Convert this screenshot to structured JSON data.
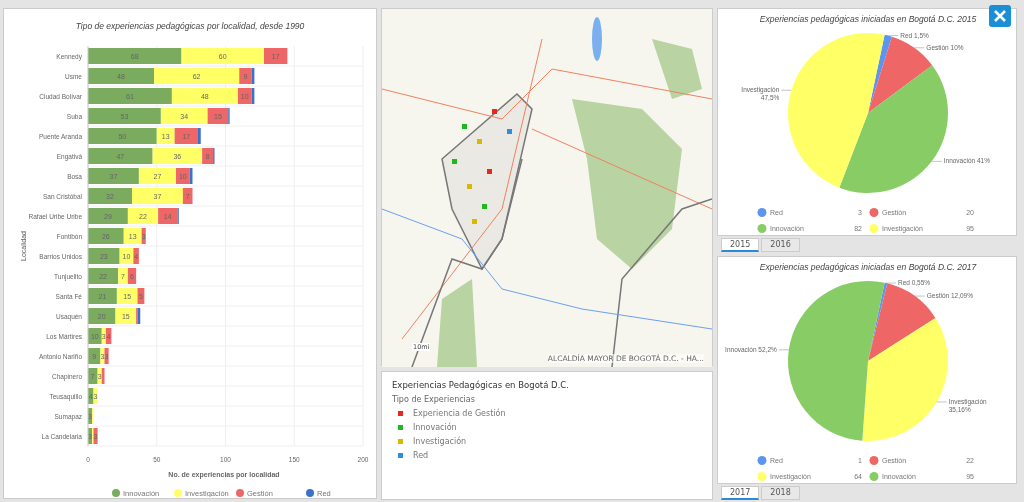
{
  "bar_panel": {
    "chart_data": {
      "type": "bar",
      "orientation": "horizontal",
      "stacked": true,
      "grid": true,
      "legend": true,
      "title": "Tipo de experiencias pedagógicas por localidad, desde 1990",
      "xlabel": "No. de experiencias por localidad",
      "ylabel": "Localidad",
      "xlim": [
        0,
        200
      ],
      "xticks": [
        0,
        50,
        100,
        150,
        200
      ],
      "categories": [
        "Kennedy",
        "Usme",
        "Ciudad Bolívar",
        "Suba",
        "Puente Aranda",
        "Engativá",
        "Bosa",
        "San Cristóbal",
        "Rafael Uribe Uribe",
        "Fontibón",
        "Barrios Unidos",
        "Tunjuelito",
        "Santa Fé",
        "Usaquén",
        "Los Mártires",
        "Antonio Nariño",
        "Chapinero",
        "Teusaquillo",
        "Sumapaz",
        "La Candelaria"
      ],
      "series": [
        {
          "name": "Innovación",
          "color": "#7aab5e",
          "values": [
            68,
            48,
            61,
            53,
            50,
            47,
            37,
            32,
            29,
            26,
            23,
            22,
            21,
            20,
            10,
            9,
            7,
            4,
            3,
            3
          ]
        },
        {
          "name": "Investigación",
          "color": "#ffff66",
          "values": [
            60,
            62,
            48,
            34,
            13,
            36,
            27,
            37,
            22,
            13,
            10,
            7,
            15,
            15,
            3,
            3,
            3,
            3,
            1,
            1
          ]
        },
        {
          "name": "Gestión",
          "color": "#ee6666",
          "values": [
            17,
            9,
            10,
            15,
            17,
            8,
            10,
            7,
            14,
            3,
            4,
            6,
            5,
            1,
            4,
            3,
            2,
            0,
            0,
            3
          ]
        },
        {
          "name": "Red",
          "color": "#3a72c8",
          "values": [
            0,
            2,
            2,
            1,
            2,
            1,
            2,
            0,
            1,
            0,
            0,
            0,
            0,
            2,
            0,
            0,
            0,
            0,
            0,
            0
          ]
        }
      ],
      "value_labels": [
        [
          "68",
          "48",
          "61",
          "53",
          "50",
          "47",
          "37",
          "32",
          "29",
          "26",
          "23",
          "22",
          "21",
          "20",
          "10",
          "9",
          "7",
          "4",
          "3",
          "3"
        ],
        [
          "60",
          "62",
          "48",
          "34",
          "13",
          "36",
          "27",
          "37",
          "22",
          "13",
          "10",
          "7",
          "15",
          "15",
          "3",
          "3",
          "3",
          "3",
          null,
          null
        ],
        [
          "17",
          "9",
          "10",
          "15",
          "17",
          "8",
          "10",
          "7",
          "14",
          "3",
          "4",
          "6",
          "5",
          null,
          "4",
          "3",
          null,
          null,
          null,
          "3"
        ],
        [
          null,
          null,
          null,
          null,
          null,
          null,
          null,
          null,
          null,
          null,
          null,
          null,
          null,
          null,
          null,
          null,
          null,
          null,
          null,
          null
        ]
      ]
    }
  },
  "map": {
    "attribution": "ALCALDÍA MAYOR DE BOGOTÁ D.C. - HA...",
    "scale": "10mi"
  },
  "map_legend": {
    "title": "Experiencias Pedagógicas en Bogotá D.C.",
    "subtitle": "Tipo de Experiencias",
    "items": [
      {
        "label": "Experiencia de Gestión",
        "color": "#e8281e"
      },
      {
        "label": "Innovación",
        "color": "#1fb81f"
      },
      {
        "label": "Investigación",
        "color": "#d8b800"
      },
      {
        "label": "Red",
        "color": "#2d8ee0"
      }
    ]
  },
  "pie_panels": [
    {
      "chart_data": {
        "type": "pie",
        "title": "Experiencias pedagógicas iniciadas en Bogotá D.C. 2015",
        "legend": true,
        "categories": [
          "Red",
          "Gestión",
          "Innovación",
          "Investigación"
        ],
        "series": [
          {
            "values": [
              1.5,
              10,
              41,
              47.5
            ],
            "colors": [
              "#5b95ee",
              "#ee6666",
              "#88cc66",
              "#ffff66"
            ]
          }
        ]
      },
      "slice_labels": [
        [
          "Red 1,5%"
        ],
        [
          "Gestión 10%"
        ],
        [
          "Innovación 41%"
        ],
        [
          "Investigación",
          "47,5%"
        ]
      ],
      "legend_values": [
        "3",
        "20",
        "82",
        "95"
      ],
      "tabs": [
        {
          "label": "2015",
          "selected": true
        },
        {
          "label": "2016",
          "selected": false
        }
      ]
    },
    {
      "chart_data": {
        "type": "pie",
        "title": "Experiencias pedagógicas iniciadas en Bogotá D.C. 2017",
        "legend": true,
        "categories": [
          "Red",
          "Gestión",
          "Investigación",
          "Innovación"
        ],
        "series": [
          {
            "values": [
              0.55,
              12.09,
              35.16,
              52.2
            ],
            "colors": [
              "#5b95ee",
              "#ee6666",
              "#ffff66",
              "#88cc66"
            ]
          }
        ]
      },
      "slice_labels": [
        [
          "Red 0,55%"
        ],
        [
          "Gestión 12,09%"
        ],
        [
          "Investigación",
          "35,16%"
        ],
        [
          "Innovación 52,2%"
        ]
      ],
      "legend_values": [
        "1",
        "22",
        "64",
        "95"
      ],
      "tabs": [
        {
          "label": "2017",
          "selected": true
        },
        {
          "label": "2018",
          "selected": false
        }
      ]
    }
  ]
}
